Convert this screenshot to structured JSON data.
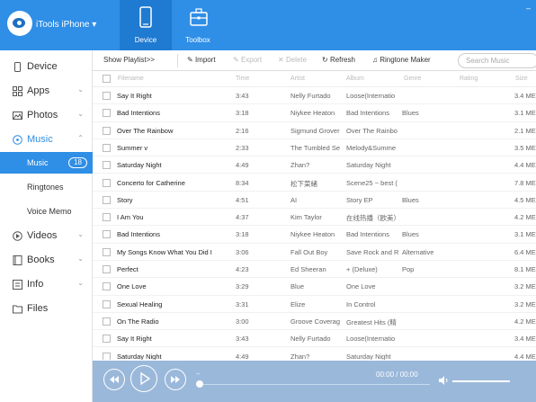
{
  "header": {
    "app_title": "iTools iPhone ▾",
    "tabs": [
      {
        "label": "Device",
        "icon": "phone-icon",
        "active": true
      },
      {
        "label": "Toolbox",
        "icon": "toolbox-icon",
        "active": false
      }
    ],
    "window_controls": "–"
  },
  "sidebar": {
    "items": [
      {
        "label": "Device",
        "icon": "device-icon"
      },
      {
        "label": "Apps",
        "icon": "apps-icon"
      },
      {
        "label": "Photos",
        "icon": "photos-icon"
      },
      {
        "label": "Music",
        "icon": "music-icon"
      },
      {
        "label": "Videos",
        "icon": "videos-icon"
      },
      {
        "label": "Books",
        "icon": "books-icon"
      },
      {
        "label": "Info",
        "icon": "info-icon"
      },
      {
        "label": "Files",
        "icon": "files-icon"
      }
    ],
    "music_sub": [
      {
        "label": "Music",
        "badge": "18"
      },
      {
        "label": "Ringtones"
      },
      {
        "label": "Voice Memo"
      }
    ]
  },
  "toolbar": {
    "show_playlist": "Show Playlist>>",
    "import": "Import",
    "export": "Export",
    "delete": "Delete",
    "refresh": "Refresh",
    "ringtone_maker": "Ringtone Maker",
    "search_placeholder": "Search Music"
  },
  "table": {
    "headers": {
      "filename": "Filename",
      "time": "Time",
      "artist": "Artist",
      "album": "Album",
      "genre": "Genre",
      "rating": "Rating",
      "size": "Size"
    },
    "rows": [
      {
        "name": "Say It Right",
        "time": "3:43",
        "artist": "Nelly Furtado",
        "album": "Loose(Internatio",
        "genre": "",
        "size": "3.4 ME"
      },
      {
        "name": "Bad Intentions",
        "time": "3:18",
        "artist": "Niykee Heaton",
        "album": "Bad Intentions",
        "genre": "Blues",
        "size": "3.1 ME"
      },
      {
        "name": "Over The Rainbow",
        "time": "2:16",
        "artist": "Sigmund Grover",
        "album": "Over The Rainbo",
        "genre": "",
        "size": "2.1 ME"
      },
      {
        "name": "Summer v",
        "time": "2:33",
        "artist": "The Tumbled Se",
        "album": "Melody&Summe",
        "genre": "",
        "size": "3.5 ME"
      },
      {
        "name": "Saturday Night",
        "time": "4:49",
        "artist": "Zhan?",
        "album": "Saturday Night",
        "genre": "",
        "size": "4.4 ME"
      },
      {
        "name": "Concerto for Catherine",
        "time": "8:34",
        "artist": "松下菜緒",
        "album": "Scene25 ~ best (",
        "genre": "",
        "size": "7.8 ME"
      },
      {
        "name": "Story",
        "time": "4:51",
        "artist": "AI",
        "album": "Story EP",
        "genre": "Blues",
        "size": "4.5 ME"
      },
      {
        "name": "I Am You",
        "time": "4:37",
        "artist": "Kim Taylor",
        "album": "在线热播（欧美）",
        "genre": "",
        "size": "4.2 ME"
      },
      {
        "name": "Bad Intentions",
        "time": "3:18",
        "artist": "Niykee Heaton",
        "album": "Bad Intentions",
        "genre": "Blues",
        "size": "3.1 ME"
      },
      {
        "name": "My Songs Know What You Did I",
        "time": "3:06",
        "artist": "Fall Out Boy",
        "album": "Save Rock and R",
        "genre": "Alternative",
        "size": "6.4 ME"
      },
      {
        "name": "Perfect",
        "time": "4:23",
        "artist": "Ed Sheeran",
        "album": "+ (Deluxe)",
        "genre": "Pop",
        "size": "8.1 ME"
      },
      {
        "name": "One Love",
        "time": "3:29",
        "artist": "Blue",
        "album": "One Love",
        "genre": "",
        "size": "3.2 ME"
      },
      {
        "name": "Sexual Healing",
        "time": "3:31",
        "artist": "Elize",
        "album": "In Control",
        "genre": "",
        "size": "3.2 ME"
      },
      {
        "name": "On The Radio",
        "time": "3:00",
        "artist": "Groove Coverag",
        "album": "Greatest Hits (精",
        "genre": "",
        "size": "4.2 ME"
      },
      {
        "name": "Say It Right",
        "time": "3:43",
        "artist": "Nelly Furtado",
        "album": "Loose(Internatio",
        "genre": "",
        "size": "3.4 ME"
      },
      {
        "name": "Saturday Night",
        "time": "4:49",
        "artist": "Zhan?",
        "album": "Saturday Night",
        "genre": "",
        "size": "4.4 ME"
      }
    ]
  },
  "player": {
    "track_title": "--",
    "time_readout": "00:00 / 00:00",
    "volume": 1.0,
    "accent": "#2f8ee6"
  }
}
